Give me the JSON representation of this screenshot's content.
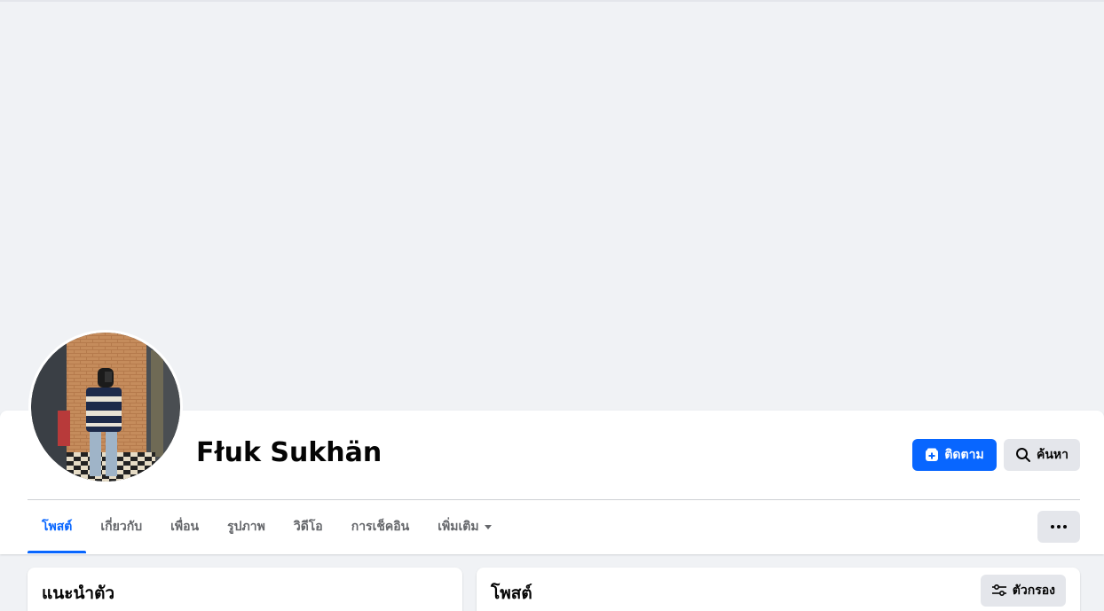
{
  "profile": {
    "name": "Fłuk Sukhän"
  },
  "actions": {
    "follow_label": "ติดตาม",
    "search_label": "ค้นหา"
  },
  "tabs": [
    {
      "label": "โพสต์",
      "active": true
    },
    {
      "label": "เกี่ยวกับ",
      "active": false
    },
    {
      "label": "เพื่อน",
      "active": false
    },
    {
      "label": "รูปภาพ",
      "active": false
    },
    {
      "label": "วิดีโอ",
      "active": false
    },
    {
      "label": "การเช็คอิน",
      "active": false
    },
    {
      "label": "เพิ่มเติม",
      "active": false
    }
  ],
  "intro": {
    "title": "แนะนำตัว"
  },
  "posts": {
    "title": "โพสต์",
    "filter_label": "ตัวกรอง"
  },
  "icons": {
    "follow": "follow-plus-icon",
    "search": "search-icon",
    "more": "more-dots-icon",
    "filter": "filter-sliders-icon",
    "tab_more": "chevron-down-icon"
  },
  "colors": {
    "accent": "#0866ff",
    "background": "#f0f2f5",
    "button_gray": "#e4e6eb",
    "text_secondary": "#65676b"
  }
}
